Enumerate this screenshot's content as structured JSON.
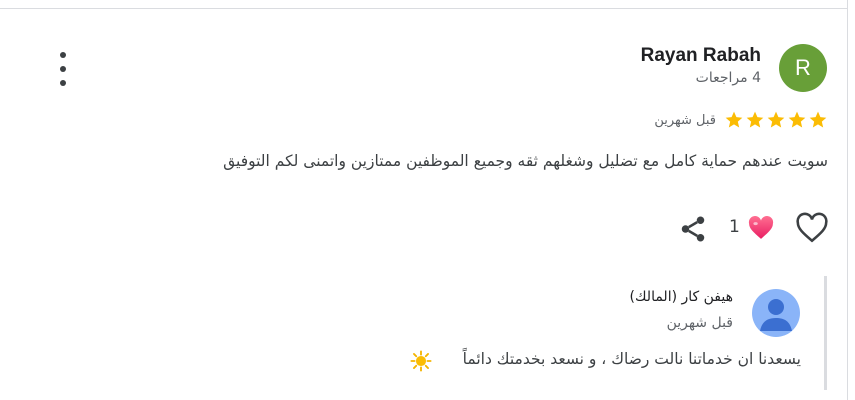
{
  "review": {
    "author": "Rayan Rabah",
    "avatar_letter": "R",
    "review_count": "4 مراجعات",
    "rating": 5,
    "time": "قبل شهرين",
    "text": "سويت عندهم حماية كامل مع تضليل وشغلهم ثقه وجميع الموظفين ممتازين واتمنى لكم التوفيق",
    "like_count": "1"
  },
  "owner_reply": {
    "name": "هيفن كار (المالك)",
    "time": "قبل شهرين",
    "text": "يسعدنا ان خدماتنا نالت رضاك ، و نسعد بخدمتك دائماً"
  },
  "icons": {
    "more": "more-vert-icon",
    "share": "share-icon",
    "like": "heart-outline-icon",
    "reaction": "heart-emoji-icon",
    "star": "star-icon",
    "sun": "sun-emoji-icon"
  },
  "colors": {
    "avatar_bg": "#689f38",
    "star": "#fbbc04",
    "owner_avatar_bg": "#8ab4f8",
    "heart": "#e91e63"
  }
}
